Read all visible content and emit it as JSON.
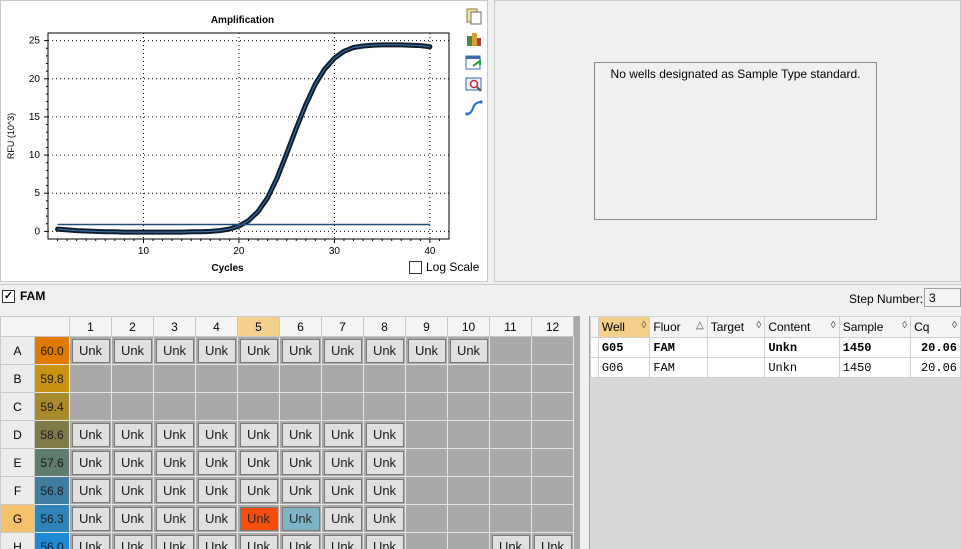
{
  "chart_data": {
    "type": "line",
    "title": "Amplification",
    "xlabel": "Cycles",
    "ylabel": "RFU (10^3)",
    "xlim": [
      0,
      42
    ],
    "ylim": [
      -1,
      26
    ],
    "x_ticks": [
      "10",
      "20",
      "30",
      "40"
    ],
    "y_ticks": [
      "0",
      "5",
      "10",
      "15",
      "20",
      "25"
    ],
    "grid": true,
    "series": [
      {
        "color": "#0d1b2a",
        "x": [
          1,
          2,
          3,
          4,
          5,
          6,
          7,
          8,
          9,
          10,
          11,
          12,
          13,
          14,
          15,
          16,
          17,
          18,
          19,
          20,
          21,
          22,
          23,
          24,
          25,
          26,
          27,
          28,
          29,
          30,
          31,
          32,
          33,
          34,
          35,
          36,
          37,
          38,
          39,
          40
        ],
        "y": [
          0.3,
          0.2,
          0.1,
          0.05,
          0.0,
          -0.05,
          -0.05,
          -0.1,
          -0.1,
          -0.1,
          -0.1,
          -0.1,
          -0.1,
          -0.1,
          -0.05,
          -0.05,
          0.0,
          0.1,
          0.3,
          0.7,
          1.4,
          2.6,
          4.4,
          7.0,
          10.2,
          13.5,
          16.6,
          19.3,
          21.3,
          22.7,
          23.6,
          24.1,
          24.3,
          24.4,
          24.45,
          24.45,
          24.45,
          24.4,
          24.35,
          24.2
        ]
      },
      {
        "color": "#1f4e79",
        "x": [
          1,
          40
        ],
        "y": [
          0.9,
          0.9
        ]
      }
    ]
  },
  "chart_toolbar": {
    "icons": [
      "copy-icon",
      "export-icon",
      "refresh-icon",
      "zoom-icon",
      "graph-icon"
    ]
  },
  "log_scale": {
    "label": "Log Scale",
    "checked": false
  },
  "standard_curve": {
    "message": "No wells designated as Sample Type standard."
  },
  "fluor_selector": {
    "label": "FAM",
    "checked": true
  },
  "step": {
    "label": "Step Number:",
    "value": "3"
  },
  "plate": {
    "columns": [
      "1",
      "2",
      "3",
      "4",
      "5",
      "6",
      "7",
      "8",
      "9",
      "10",
      "11",
      "12"
    ],
    "selected_column": "5",
    "selected_row": "G",
    "rows": [
      {
        "label": "A",
        "temp": "60.0",
        "color": "#e07b00",
        "cells": [
          "Unk",
          "Unk",
          "Unk",
          "Unk",
          "Unk",
          "Unk",
          "Unk",
          "Unk",
          "Unk",
          "Unk",
          "",
          ""
        ]
      },
      {
        "label": "B",
        "temp": "59.8",
        "color": "#c99414",
        "cells": [
          "",
          "",
          "",
          "",
          "",
          "",
          "",
          "",
          "",
          "",
          "",
          ""
        ]
      },
      {
        "label": "C",
        "temp": "59.4",
        "color": "#a88a2c",
        "cells": [
          "",
          "",
          "",
          "",
          "",
          "",
          "",
          "",
          "",
          "",
          "",
          ""
        ]
      },
      {
        "label": "D",
        "temp": "58.6",
        "color": "#7f7a4a",
        "cells": [
          "Unk",
          "Unk",
          "Unk",
          "Unk",
          "Unk",
          "Unk",
          "Unk",
          "Unk",
          "",
          "",
          "",
          ""
        ]
      },
      {
        "label": "E",
        "temp": "57.6",
        "color": "#5e7d6e",
        "cells": [
          "Unk",
          "Unk",
          "Unk",
          "Unk",
          "Unk",
          "Unk",
          "Unk",
          "Unk",
          "",
          "",
          "",
          ""
        ]
      },
      {
        "label": "F",
        "temp": "56.8",
        "color": "#3f7ea0",
        "cells": [
          "Unk",
          "Unk",
          "Unk",
          "Unk",
          "Unk",
          "Unk",
          "Unk",
          "Unk",
          "",
          "",
          "",
          ""
        ]
      },
      {
        "label": "G",
        "temp": "56.3",
        "color": "#2f85b8",
        "cells": [
          "Unk",
          "Unk",
          "Unk",
          "Unk",
          "Unk",
          "Unk",
          "Unk",
          "Unk",
          "",
          "",
          "",
          ""
        ]
      },
      {
        "label": "H",
        "temp": "56.0",
        "color": "#1e8ad6",
        "cells": [
          "Unk",
          "Unk",
          "Unk",
          "Unk",
          "Unk",
          "Unk",
          "Unk",
          "Unk",
          "",
          "",
          "Unk",
          "Unk"
        ]
      }
    ],
    "highlight": {
      "G5": "orange",
      "G6": "teal"
    }
  },
  "results": {
    "headers": [
      "Well",
      "Fluor",
      "Target",
      "Content",
      "Sample",
      "Cq"
    ],
    "rows": [
      {
        "bold": true,
        "cells": [
          "G05",
          "FAM",
          "",
          "Unkn",
          "1450",
          "20.06"
        ]
      },
      {
        "bold": false,
        "cells": [
          "G06",
          "FAM",
          "",
          "Unkn",
          "1450",
          "20.06"
        ]
      }
    ]
  }
}
